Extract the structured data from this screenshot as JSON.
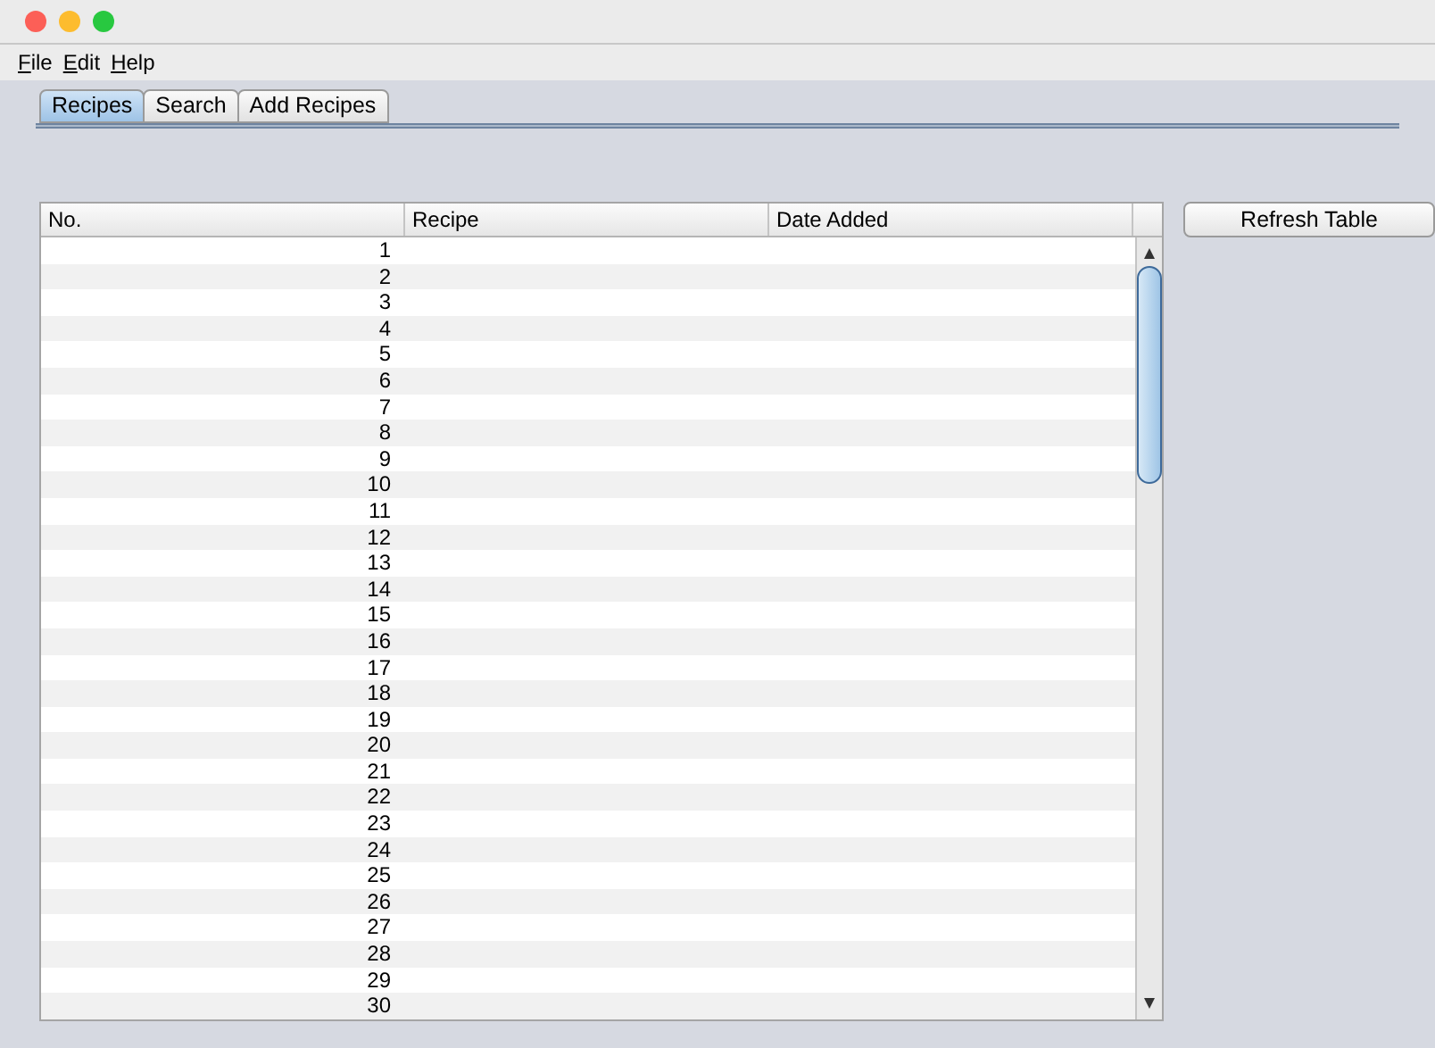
{
  "menu": [
    "File",
    "Edit",
    "Help"
  ],
  "tabs": [
    {
      "label": "Recipes",
      "selected": true
    },
    {
      "label": "Search",
      "selected": false
    },
    {
      "label": "Add Recipes",
      "selected": false
    }
  ],
  "table": {
    "columns": [
      "No.",
      "Recipe",
      "Date Added"
    ],
    "rows": [
      "1",
      "2",
      "3",
      "4",
      "5",
      "6",
      "7",
      "8",
      "9",
      "10",
      "11",
      "12",
      "13",
      "14",
      "15",
      "16",
      "17",
      "18",
      "19",
      "20",
      "21",
      "22",
      "23",
      "24",
      "25",
      "26",
      "27",
      "28",
      "29",
      "30"
    ]
  },
  "refresh_button": "Refresh Table"
}
